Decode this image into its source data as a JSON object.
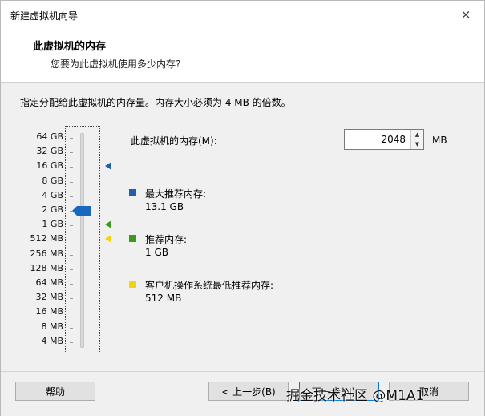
{
  "window": {
    "title": "新建虚拟机向导",
    "close_glyph": "×"
  },
  "header": {
    "title": "此虚拟机的内存",
    "subtitle": "您要为此虚拟机使用多少内存?"
  },
  "instruction": "指定分配给此虚拟机的内存量。内存大小必须为 4 MB 的倍数。",
  "scale": [
    "64 GB",
    "32 GB",
    "16 GB",
    "8 GB",
    "4 GB",
    "2 GB",
    "1 GB",
    "512 MB",
    "256 MB",
    "128 MB",
    "64 MB",
    "32 MB",
    "16 MB",
    "8 MB",
    "4 MB"
  ],
  "memory": {
    "label": "此虚拟机的内存(M):",
    "value": "2048",
    "unit": "MB",
    "slider_level": "2 GB"
  },
  "legend": [
    {
      "title": "最大推荐内存:",
      "value": "13.1 GB",
      "color": "#1f5fa8",
      "scale_level": "16 GB"
    },
    {
      "title": "推荐内存:",
      "value": "1 GB",
      "color": "#3a9a1e",
      "scale_level": "1 GB"
    },
    {
      "title": "客户机操作系统最低推荐内存:",
      "value": "512 MB",
      "color": "#f2d30f",
      "scale_level": "512 MB"
    }
  ],
  "buttons": {
    "help": "帮助",
    "back": "< 上一步(B)",
    "next": "下一步(N) >",
    "cancel": "取消"
  },
  "watermark": "掘金技术社区 @M1A1",
  "colors": {
    "thumb": "#1a67c0",
    "accent": "#0078d7"
  }
}
